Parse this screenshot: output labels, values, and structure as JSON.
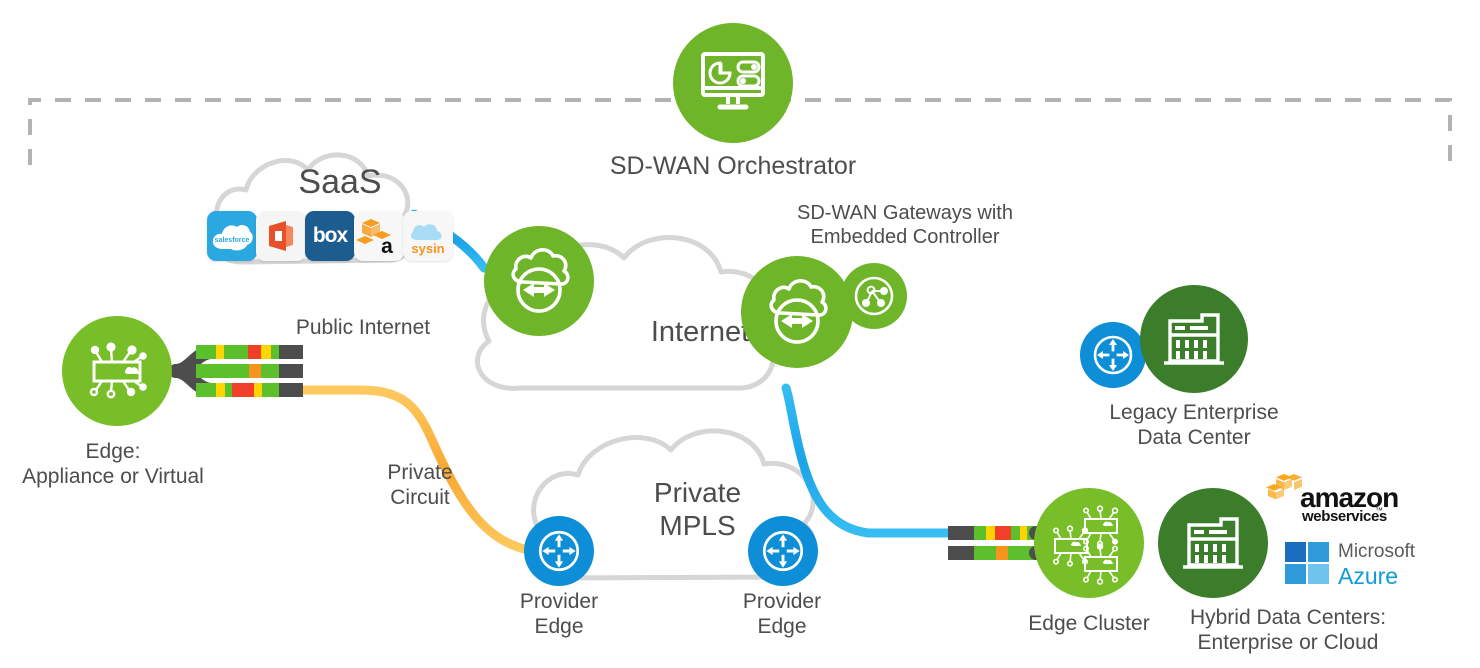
{
  "theme": {
    "green_light": "#78be28",
    "green_mid": "#6fb52a",
    "green_dark": "#3b7d2b",
    "blue": "#0d8ed6",
    "blue_line": "#2eb0ef",
    "orange_line": "#fbb03b",
    "cloud_stroke": "#d2d2d2",
    "dash_border": "#b3b3b3",
    "text": "#4d4d4d",
    "cable_dark": "#4d4d4d",
    "cable_green": "#5cc02c",
    "cable_yellow": "#ffd400",
    "cable_red": "#f0402a",
    "cable_orange": "#f7941e"
  },
  "boundary": {
    "name": "sd-wan-domain-boundary",
    "style": "dashed"
  },
  "nodes": {
    "orchestrator": {
      "label": "SD-WAN Orchestrator",
      "icon": "monitor-dashboard-icon",
      "color": "#6fb52a"
    },
    "saas_cloud": {
      "label": "SaaS",
      "icon": "cloud-outline-icon"
    },
    "internet_cloud": {
      "label": "Internet",
      "icon": "cloud-outline-icon"
    },
    "mpls_cloud": {
      "label": "Private\nMPLS",
      "icon": "cloud-outline-icon"
    },
    "edge": {
      "label": "Edge:\nAppliance or Virtual",
      "icon": "edge-chip-icon",
      "color": "#78be28"
    },
    "edge_gw_left": {
      "label": "",
      "icon": "cloud-bidirectional-arrow-icon",
      "color": "#6fb52a"
    },
    "gateways": {
      "label": "SD-WAN Gateways with\nEmbedded Controller",
      "icon": "cloud-bidirectional-arrow-icon",
      "color": "#6fb52a"
    },
    "controller": {
      "label": "",
      "icon": "network-topology-icon",
      "color": "#6fb52a"
    },
    "legacy_dc": {
      "label": "Legacy Enterprise\nData Center",
      "icon": "data-center-building-icon",
      "color": "#3b7d2b"
    },
    "legacy_dc_router": {
      "label": "",
      "icon": "router-four-arrow-icon",
      "color": "#0d8ed6"
    },
    "provider_edge_left": {
      "label": "Provider\nEdge",
      "icon": "router-four-arrow-icon",
      "color": "#0d8ed6"
    },
    "provider_edge_right": {
      "label": "Provider\nEdge",
      "icon": "router-four-arrow-icon",
      "color": "#0d8ed6"
    },
    "edge_cluster": {
      "label": "Edge Cluster",
      "icon": "edge-cluster-chip-icon",
      "color": "#78be28"
    },
    "hybrid_dc": {
      "label": "Hybrid Data Centers:\nEnterprise or Cloud",
      "icon": "data-center-building-icon",
      "color": "#3b7d2b"
    }
  },
  "links": {
    "public_internet": {
      "label": "Public Internet",
      "color": "#2eb0ef"
    },
    "private_circuit": {
      "label": "Private\nCircuit",
      "color": "#fbb03b"
    }
  },
  "saas_logos": [
    {
      "name": "salesforce-logo",
      "text": "salesforce",
      "bg": "#2ba8e0",
      "fg": "#ffffff"
    },
    {
      "name": "office-logo",
      "text": "",
      "bg": "#f5f5f5",
      "fg": "#e8502a"
    },
    {
      "name": "box-logo",
      "text": "box",
      "bg": "#1d5c8f",
      "fg": "#ffffff"
    },
    {
      "name": "aws-logo",
      "text": "a",
      "bg": "#f7f7f7",
      "fg": "#f59d1f"
    },
    {
      "name": "sysin-logo",
      "text": "sysin",
      "bg": "#f7f7f7",
      "fg": "#f7941e"
    }
  ],
  "cloud_provider_logos": [
    {
      "name": "amazon-web-services-logo",
      "line1": "amazon",
      "line2": "webservices",
      "tm": "™",
      "color": "#000000",
      "accent": "#f7a81b"
    },
    {
      "name": "microsoft-azure-logo",
      "line1": "Microsoft",
      "line2": "Azure",
      "color": "#0f9bd7",
      "accent": "#0f9bd7"
    }
  ]
}
